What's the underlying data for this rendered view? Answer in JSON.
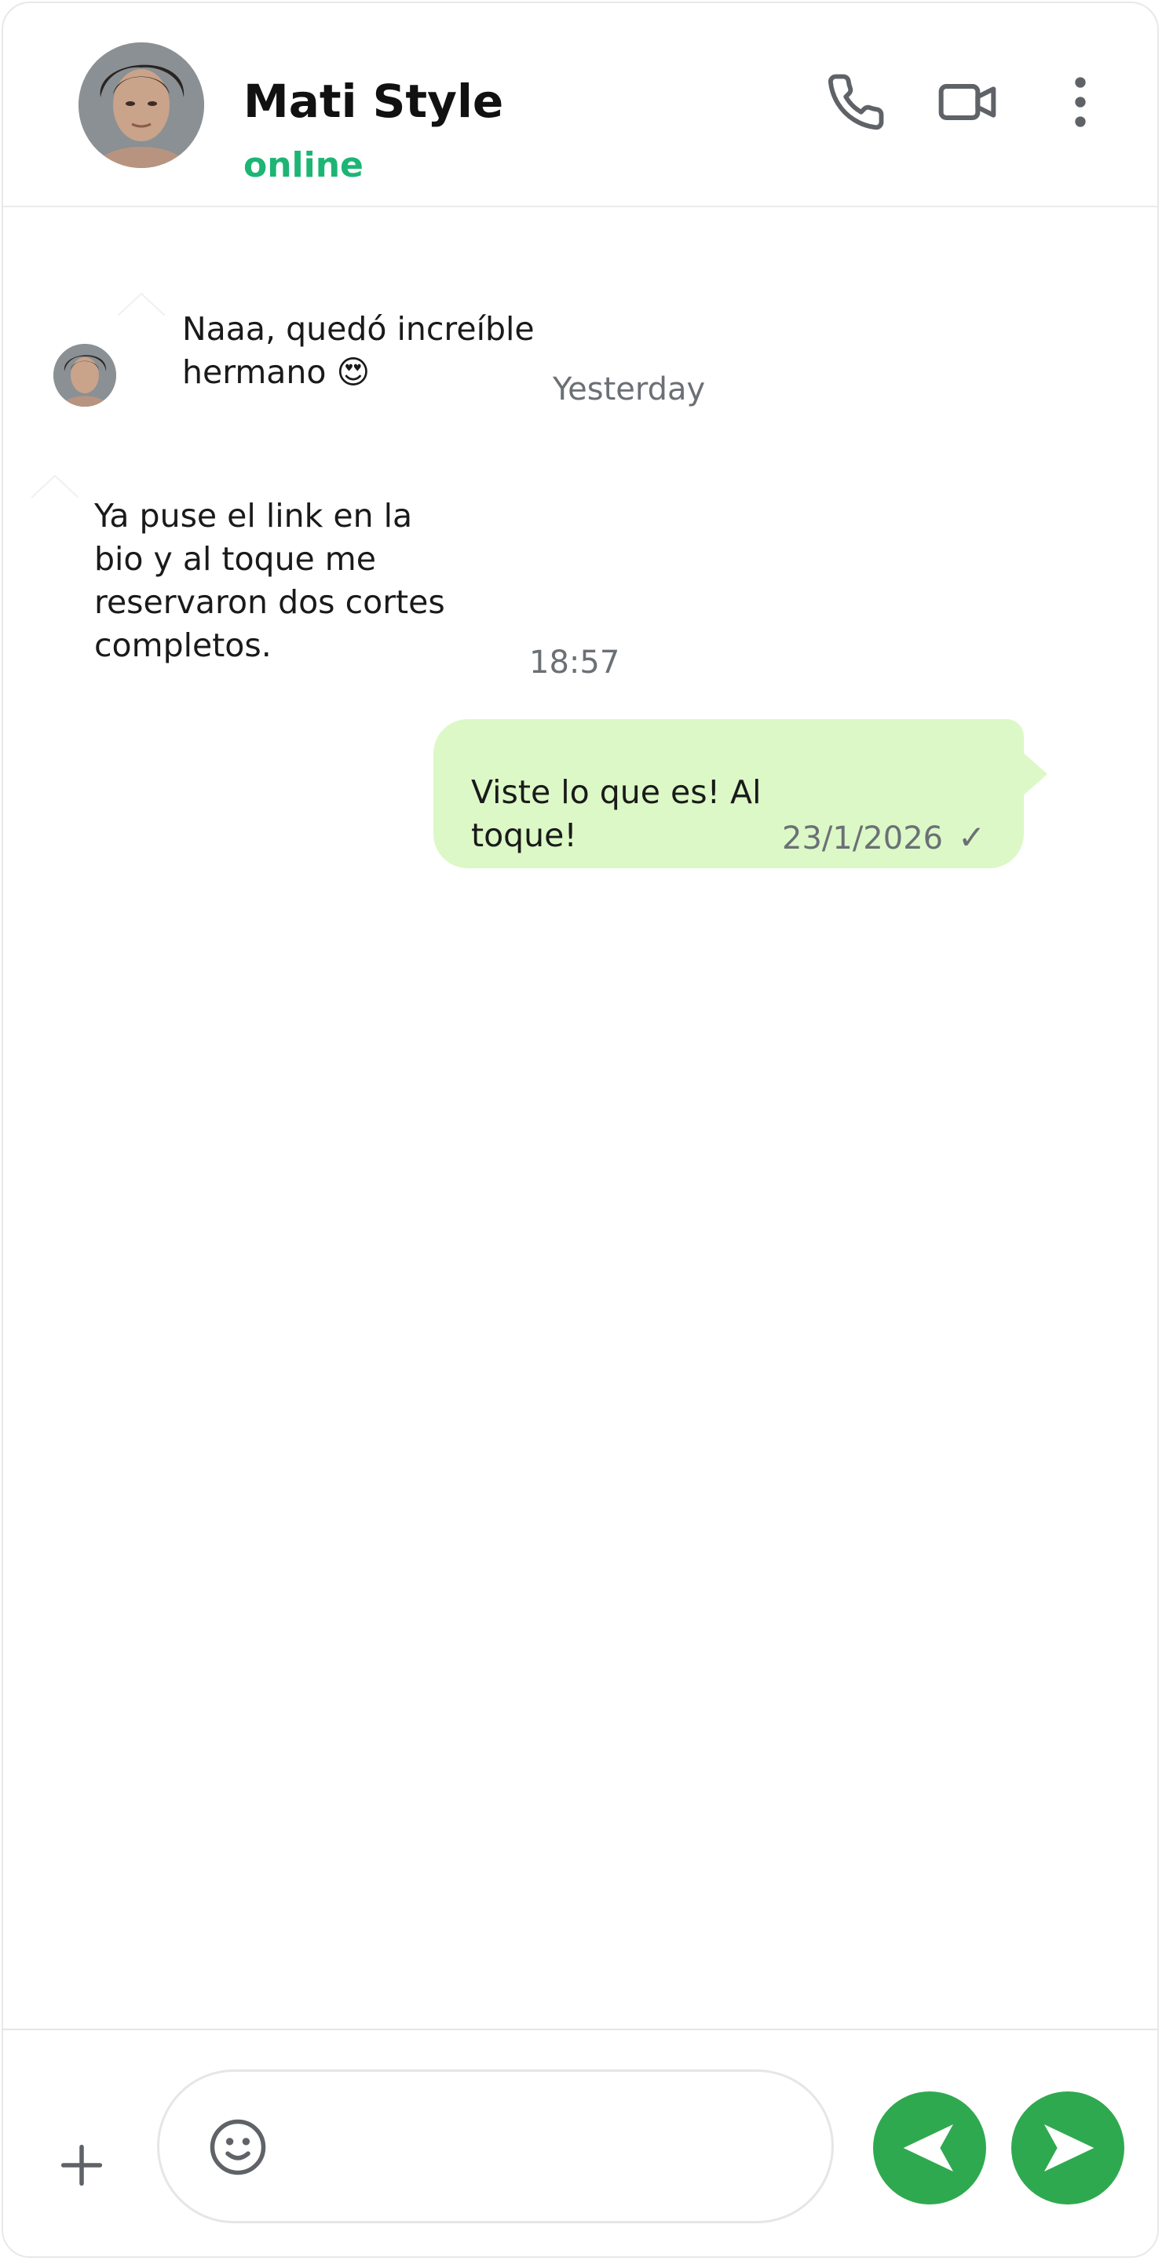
{
  "contact": {
    "name": "Mati Style",
    "status": "online",
    "status_color": "#1db574"
  },
  "header": {
    "icons": [
      "phone-icon",
      "video-camera-icon",
      "more-vertical-icon"
    ]
  },
  "messages": [
    {
      "direction": "incoming",
      "lines": [
        "Naaa, quedó increíble",
        "hermano 😍"
      ],
      "time": "Yesterday",
      "has_avatar": true
    },
    {
      "direction": "incoming",
      "lines": [
        "Ya puse el link en la",
        "bio y al toque me",
        "reservaron dos cortes",
        "completos."
      ],
      "time": "18:57",
      "has_avatar": false
    },
    {
      "direction": "outgoing",
      "lines": [
        "Viste lo que es! Al",
        "toque!"
      ],
      "time": "23/1/2026",
      "status_icon": "single-check-icon",
      "check": "✓",
      "bubble_color": "#dcf8c6"
    }
  ],
  "composer": {
    "placeholder": "",
    "value": "",
    "accent_color": "#2fa94f",
    "icons": [
      "plus-icon",
      "emoji-icon",
      "back-arrow-icon",
      "send-icon"
    ]
  }
}
